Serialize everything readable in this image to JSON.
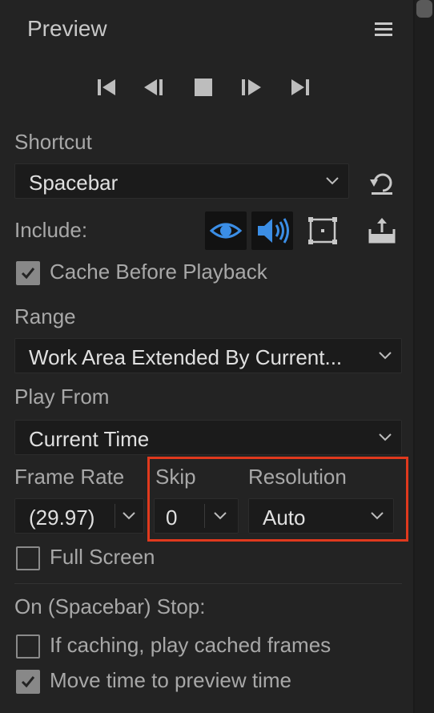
{
  "panel": {
    "title": "Preview"
  },
  "colors": {
    "accent_blue": "#3b8ee6",
    "highlight_red": "#e0391d"
  },
  "transport": {
    "buttons": [
      {
        "name": "first-frame",
        "icon": "skip-to-start-icon"
      },
      {
        "name": "previous-frame",
        "icon": "step-back-icon"
      },
      {
        "name": "stop",
        "icon": "stop-icon"
      },
      {
        "name": "next-frame",
        "icon": "step-forward-icon"
      },
      {
        "name": "last-frame",
        "icon": "skip-to-end-icon"
      }
    ]
  },
  "shortcut": {
    "label": "Shortcut",
    "value": "Spacebar"
  },
  "include": {
    "label": "Include:",
    "video_on": true,
    "audio_on": true,
    "overlays_on": false
  },
  "cache_before_playback": {
    "label": "Cache Before Playback",
    "checked": true
  },
  "range": {
    "label": "Range",
    "value": "Work Area Extended By Current..."
  },
  "play_from": {
    "label": "Play From",
    "value": "Current Time"
  },
  "frame_rate": {
    "label": "Frame Rate",
    "value": "(29.97)"
  },
  "skip": {
    "label": "Skip",
    "value": "0"
  },
  "resolution": {
    "label": "Resolution",
    "value": "Auto"
  },
  "full_screen": {
    "label": "Full Screen",
    "checked": false
  },
  "on_stop": {
    "label": "On (Spacebar) Stop:",
    "play_cached": {
      "label": "If caching, play cached frames",
      "checked": false
    },
    "move_time": {
      "label": "Move time to preview time",
      "checked": true
    }
  }
}
